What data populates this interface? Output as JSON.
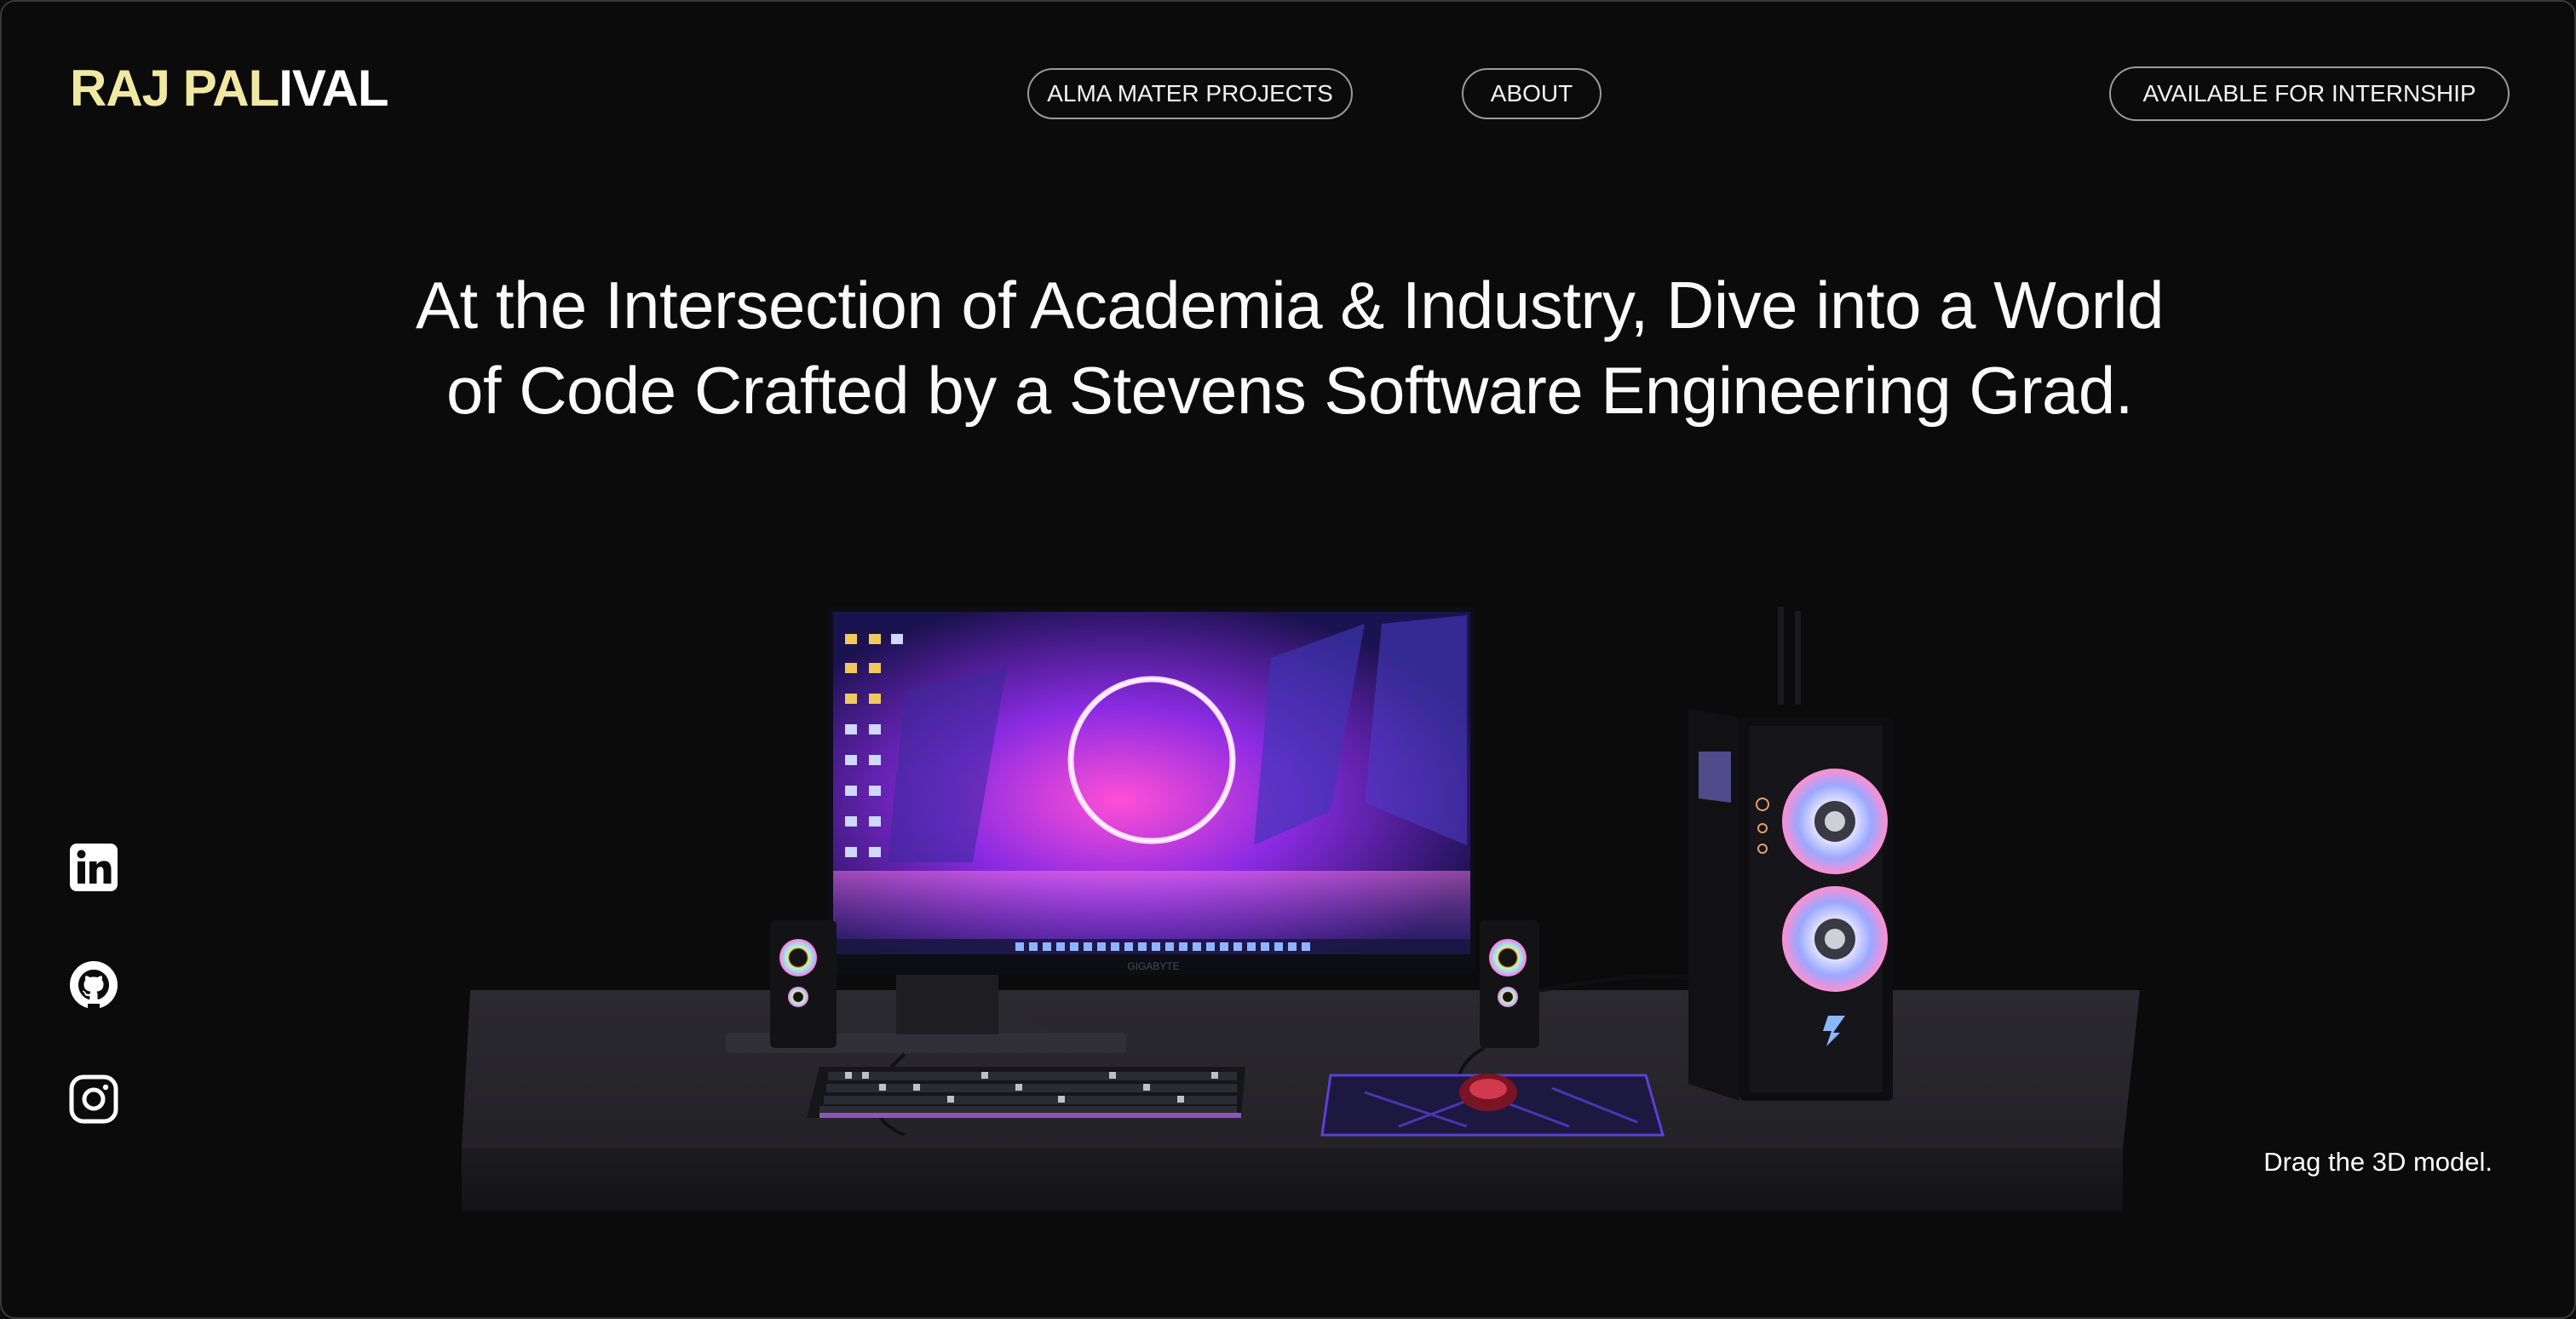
{
  "logo": {
    "part1": "RAJ PAL",
    "part2": "IVAL"
  },
  "nav": {
    "projects_label": "ALMA MATER PROJECTS",
    "about_label": "ABOUT",
    "internship_label": "AVAILABLE FOR INTERNSHIP"
  },
  "hero": {
    "line1": "At the Intersection of Academia & Industry, Dive into a World",
    "line2": "of Code Crafted by a Stevens Software Engineering Grad."
  },
  "scene": {
    "hint": "Drag the 3D model.",
    "monitor_brand": "GIGABYTE"
  },
  "social": {
    "items": [
      "linkedin-icon",
      "github-icon",
      "instagram-icon"
    ]
  },
  "colors": {
    "background": "#0b0b0b",
    "logo_gradient_start": "#f3eca0",
    "logo_gradient_end": "#ffffff",
    "text": "#ffffff",
    "pill_border": "#9a9a9a"
  }
}
